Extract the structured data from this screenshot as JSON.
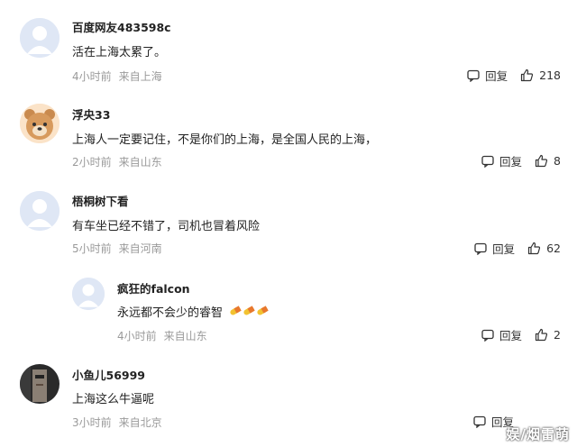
{
  "comments": [
    {
      "username": "百度网友483598c",
      "text": "活在上海太累了。",
      "time": "4小时前",
      "location": "来自上海",
      "reply_label": "回复",
      "likes": "218",
      "avatar": "default-avatar-icon"
    },
    {
      "username": "浮央33",
      "text": "上海人一定要记住，不是你们的上海，是全国人民的上海，",
      "time": "2小时前",
      "location": "来自山东",
      "reply_label": "回复",
      "likes": "8",
      "avatar": "bear-avatar"
    },
    {
      "username": "梧桐树下看",
      "text": "有车坐已经不错了，司机也冒着风险",
      "time": "5小时前",
      "location": "来自河南",
      "reply_label": "回复",
      "likes": "62",
      "avatar": "default-avatar-icon"
    },
    {
      "username": "疯狂的falcon",
      "text": "永远都不会少的睿智",
      "time": "4小时前",
      "location": "来自山东",
      "reply_label": "回复",
      "likes": "2",
      "avatar": "default-avatar-icon",
      "emoji": "pill-icon"
    },
    {
      "username": "小鱼儿56999",
      "text": "上海这么牛逼呢",
      "time": "3小时前",
      "location": "来自北京",
      "reply_label": "回复",
      "likes": "",
      "avatar": "photo-avatar"
    }
  ],
  "watermark": "娱/烟雷萌",
  "colors": {
    "meta": "#9a9a9a",
    "avatar_bg": "#dfe7f5",
    "text": "#222222"
  }
}
